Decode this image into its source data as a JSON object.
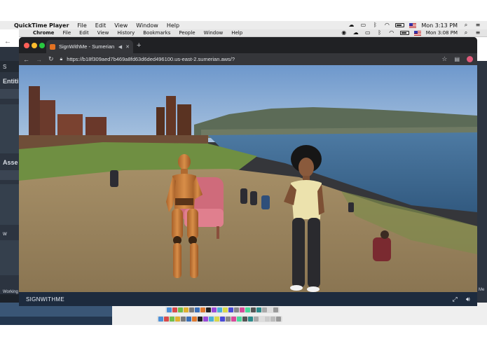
{
  "outer_menubar": {
    "apple": "",
    "app_name": "QuickTime Player",
    "menus": [
      "File",
      "Edit",
      "View",
      "Window",
      "Help"
    ],
    "clock": "Mon 3:13 PM",
    "icons": [
      "cloud-icon",
      "airplay-icon",
      "bluetooth-icon",
      "wifi-icon",
      "battery-icon",
      "flag-us-icon",
      "search-icon",
      "list-icon"
    ]
  },
  "inner_menubar": {
    "apple": "",
    "app_name": "Chrome",
    "menus": [
      "File",
      "Edit",
      "View",
      "History",
      "Bookmarks",
      "People",
      "Window",
      "Help"
    ],
    "clock": "Mon 3:08 PM",
    "icons": [
      "record-icon",
      "cloud-icon",
      "airplay-icon",
      "bluetooth-icon",
      "wifi-icon",
      "battery-icon",
      "flag-us-icon",
      "search-icon",
      "list-icon"
    ]
  },
  "background_app": {
    "fragments": [
      "S",
      "Entiti",
      "Asse",
      "w",
      "Working",
      "Me"
    ],
    "colors": {
      "panel": "#2c3440",
      "footer": "#3a5676"
    }
  },
  "browser": {
    "tab": {
      "title": "SignWithMe - Sumerian",
      "favicon": "sumerian-cube-icon"
    },
    "url": "https://b18f309aed7b469a8fd63d6ded496100.us-east-2.sumerian.aws/?",
    "toolbar_icons": [
      "back-arrow-icon",
      "forward-arrow-icon",
      "reload-icon",
      "lock-icon",
      "star-icon",
      "extension-icon",
      "profile-icon"
    ],
    "traffic_lights": {
      "close": "#fe5f57",
      "minimize": "#febc2e",
      "zoom": "#28c840"
    }
  },
  "scene": {
    "description_free": true,
    "colors": {
      "sky": "#7ba4d4",
      "water": "#3f6a90",
      "grass": "#6f8f42",
      "ground": "#9b8560",
      "mannequin": "#c77a35",
      "chair": "#d86c80"
    }
  },
  "appbar": {
    "title": "SIGNWITHME",
    "icons": [
      "fullscreen-icon",
      "volume-icon"
    ],
    "color": "#1d2b3e"
  }
}
